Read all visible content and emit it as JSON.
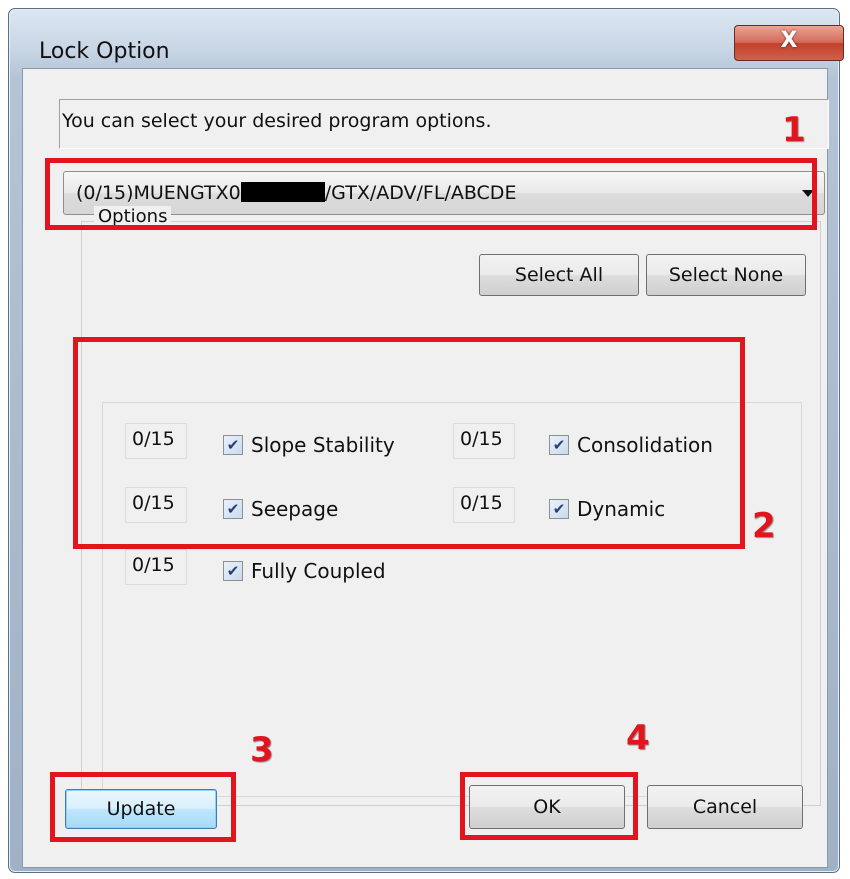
{
  "window": {
    "title": "Lock Option",
    "close_glyph": "X"
  },
  "instruction": "You can select your desired program options.",
  "license_combo": {
    "prefix": "(0/15)MUENGTX0",
    "suffix": "/GTX/ADV/FL/ABCDE"
  },
  "options_group": {
    "label": "Options",
    "select_all": "Select All",
    "select_none": "Select None",
    "items": [
      {
        "count": "0/15",
        "label": "Slope Stability",
        "checked": true
      },
      {
        "count": "0/15",
        "label": "Consolidation",
        "checked": true
      },
      {
        "count": "0/15",
        "label": "Seepage",
        "checked": true
      },
      {
        "count": "0/15",
        "label": "Dynamic",
        "checked": true
      },
      {
        "count": "0/15",
        "label": "Fully Coupled",
        "checked": true
      }
    ]
  },
  "footer": {
    "update": "Update",
    "ok": "OK",
    "cancel": "Cancel"
  },
  "annotations": [
    "1",
    "2",
    "3",
    "4"
  ],
  "colors": {
    "annotation_red": "#e2141d",
    "close_red": "#c2402c"
  },
  "icons": {
    "checkbox_check": "check-icon",
    "dropdown": "chevron-down-icon"
  }
}
